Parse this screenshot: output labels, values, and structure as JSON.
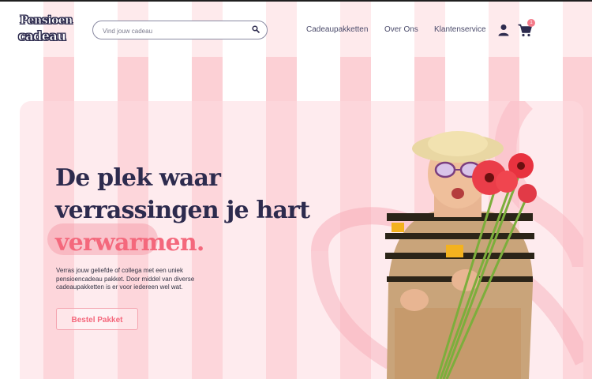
{
  "brand": {
    "logo_line1": "Pensioen",
    "logo_line2": "cadeau"
  },
  "search": {
    "placeholder": "Vind jouw cadeau"
  },
  "nav": {
    "items": [
      "Cadeaupakketten",
      "Over Ons",
      "Klantenservice"
    ]
  },
  "cart": {
    "count": "1"
  },
  "hero": {
    "headline_line1": "De plek waar",
    "headline_line2": "verrassingen je hart",
    "headline_accent": "verwarmen.",
    "intro": "Verras jouw geliefde of collega met een uniek pensioencadeau pakket. Door middel van diverse cadeaupakketten is er voor iedereen wel wat.",
    "cta_label": "Bestel Pakket"
  },
  "colors": {
    "brand_navy": "#2d2b4e",
    "accent_pink": "#f4687c",
    "stripe_pink": "#fcd0d5"
  },
  "icons": [
    "search-icon",
    "user-icon",
    "cart-icon"
  ]
}
